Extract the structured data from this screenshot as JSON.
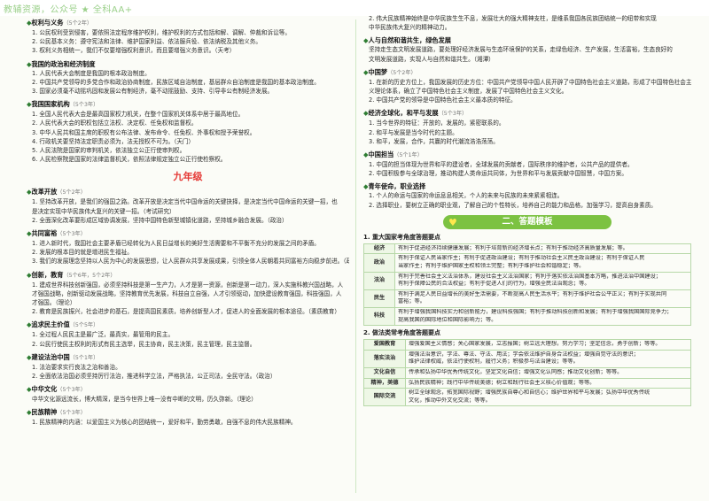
{
  "watermark": "教辅资源，公众号 ★ 全科AA+",
  "left": {
    "s1_title": "权利与义务",
    "s1_ref": "（5个2年）",
    "s1_items": [
      "1. 公民权利受到侵害，要依照法定程序维护权利，维护权利的方式包括和解、调解、仲裁和诉讼等。",
      "2. 公民基本义务：遵守宪法和法律、维护国家利益、依法服兵役、依法纳税及其他义务。",
      "3. 权利义务相统一，我们不仅要增强权利意识，而且要增强义务意识。（天考）"
    ],
    "s2_title": "我国的政治和经济制度",
    "s2_items": [
      "1. 人民代表大会制度是我国的根本政治制度。",
      "2. 中国共产党领导的多党合作和政治协商制度，民族区域自治制度，基层群众自治制度是我国的基本政治制度。",
      "3. 国家必须毫不动摇巩固和发展公有制经济，毫不动摇鼓励、支持、引导非公有制经济发展。"
    ],
    "s3_title": "我国国家机构",
    "s3_ref": "（5个3年）",
    "s3_items": [
      "1. 全国人民代表大会是最高国家权力机关，在整个国家机关体系中居于最高地位。",
      "2. 人民代表大会的职权包括立法权、决定权、任免权和监督权。",
      "3. 中华人民共和国主席的职权有公布法律、发布命令、任免权、外事权和授予荣誉权。",
      "4. 行政机关要坚持法定职责必须为，法无授权不可为。（天门）",
      "5. 人民法院是国家的审判机关，依法独立公正行使审判权。",
      "6. 人民检察院是国家的法律监督机关，依照法律规定独立公正行使检察权。"
    ],
    "grade": "九年级",
    "s4_title": "改革开放",
    "s4_ref": "（5个2年）",
    "s4_items": [
      "1. 坚持改革开放，是我们的强国之路。改革开放是决定当代中国命运的关键抉择，是决定当代中国命运的关键一招，也",
      "   是决定实现中华民族伟大复兴的关键一招。（考试研究）",
      "2. 全面深化改革要形成区域协调发展，坚持中国特色新型城镇化道路，坚持城乡融合发展。（政治）"
    ],
    "s5_title": "共同富裕",
    "s5_ref": "（5个3年）",
    "s5_items": [
      "1. 进入新时代，我国社会主要矛盾已经转化为人民日益增长的美好生活需要和不平衡不充分的发展之间的矛盾。",
      "2. 发展的根本目的就是增进民生福祉。",
      "3. 我们的发展理念坚持以人民为中心的发展思想，让人民群众共享发展成果，引领全体人民朝着共同富裕方向稳步前进。（政治）"
    ],
    "s6_title": "创新，教育",
    "s6_ref": "（5个6年，5个2年）",
    "s6_items": [
      "1. 建成世界科技创新强国，必须坚持科技是第一生产力，人才是第一资源，创新是第一动力，深入实施科教兴国战略，人",
      "   才强国战略，创新驱动发展战略，坚持教育优先发展，科技自立自强，人才引领驱动，加快建设教育强国，科技强国，人",
      "   才强国。（理论）",
      "2. 教育是民族振兴，社会进步的基石，是提高国民素质，培养创新型人才，促进人的全面发展的根本途径。（素质教育）"
    ],
    "s7_title": "追求民主价值",
    "s7_ref": "（5个5年）",
    "s7_items": [
      "1. 全过程人民民主是最广泛，最真实，最管用的民主。",
      "2. 公民行使民主权利的形式有民主选举，民主协商，民主决策，民主管理，民主监督。"
    ],
    "s8_title": "建设法治中国",
    "s8_ref": "（5个1年）",
    "s8_items": [
      "1. 法治要求实行良法之治和善治。",
      "2. 全面依法治国必须坚持厉行法治，推进科学立法，严格执法，公正司法，全民守法。（政治）"
    ],
    "s9_title": "中华文化",
    "s9_ref": "（5个3年）",
    "s9_items": [
      "   中华文化源远流长，博大精深，是当今世界上唯一没有中断的文明，历久弥新。（理论）"
    ],
    "s10_title": "民族精神",
    "s10_ref": "（5个3年）",
    "s10_items": [
      "1. 民族精神的内涵：以爱国主义为核心的团结统一，爱好和平，勤劳勇敢，自强不息的伟大民族精神。"
    ]
  },
  "right": {
    "r0_items": [
      "2. 伟大民族精神始终是中华民族生生不息，发展壮大的强大精神支柱，是维系我国各民族团结统一的纽带和实现",
      "   中华民族伟大复兴的精神动力。"
    ],
    "r1_title": "人与自然和谐共生，绿色发展",
    "r1_items": [
      "   坚持走生态文明发展道路，要处理好经济发展与生态环境保护的关系，走绿色经济、生产发展，生活富裕，生态良好的",
      "   文明发展道路，实现人与自然和谐共生。（湘潭）"
    ],
    "r2_title": "中国梦",
    "r2_ref": "（5个2年）",
    "r2_items": [
      "1. 在新的历史方位上，我国发展的历史方位：中国共产党领导中国人民开辟了中国特色社会主义道路，形成了中国特色社会主",
      "   义理论体系，确立了中国特色社会主义制度，发展了中国特色社会主义文化。",
      "2. 中国共产党的领导是中国特色社会主义最本质的特征。"
    ],
    "r3_title": "经济全球化，和平与发展",
    "r3_ref": "（5个3年）",
    "r3_items": [
      "1. 当今世界的特征：开放的，发展的，紧密联系的。",
      "2. 和平与发展是当今时代的主题。",
      "3. 和平，发展，合作，共赢的时代潮流浩浩荡荡。"
    ],
    "r4_title": "中国担当",
    "r4_ref": "（5个1年）",
    "r4_items": [
      "1. 中国的担当体现为世界和平的建设者，全球发展的贡献者，国际秩序的维护者，公共产品的提供者。",
      "2. 中国积极参与全球治理，推动构建人类命运共同体，为世界和平与发展贡献中国智慧，中国方案。"
    ],
    "r5_title": "青年使命，职业选择",
    "r5_items": [
      "1. 个人的命运与国家的命运息息相关，个人的未来与民族的未来紧紧相连。",
      "2. 选择职业，要树立正确的职业观，了解自己的个性特长，培养自己的能力和品格，加强学习，提高自身素质。"
    ],
    "banner": "二、答题模板",
    "t1_title": "1. 重大国家考角度答题要点",
    "t1_rows": [
      {
        "key": "经济",
        "lines": [
          "有利于促进经济持续健康发展；有利于培育新的经济增长点；有利于推动经济高质量发展；等。"
        ]
      },
      {
        "key": "政治",
        "lines": [
          "有利于保证人民当家作主；有利于促进政治建设；有利于推动社会主义民主政治建设；有利于保证人民",
          "当家作主；有利于维护国家主权和领土完整；有利于维护社会和谐稳定；等。"
        ]
      },
      {
        "key": "法治",
        "lines": [
          "有利于完善社会主义法治体系，建设社会主义法治国家；有利于落实依法治国基本方略，推进法治中国建设；",
          "有利于保障公民的合法权益；有利于促进人们的行为，增强全民法治观念；等。"
        ]
      },
      {
        "key": "民生",
        "lines": [
          "有利于满足人民日益增长的美好生活需要，不断提高人民生活水平；有利于维护社会公平正义；有利于实现共同",
          "富裕；等。"
        ]
      },
      {
        "key": "科技",
        "lines": [
          "有利于增强我国科技实力和创新能力，建设科技强国；有利于推动科技创新和发展；有利于增强我国国际竞争力；",
          "提高我国的国际地位和国际影响力；等。"
        ]
      }
    ],
    "t2_title": "2. 做法类常考角度答题要点",
    "t2_rows": [
      {
        "key": "爱国教育",
        "lines": [
          "增强爱国主义情感；关心国家发展，立志报国；树立远大理想，努力学习；坚定信念，勇于创新；等等。"
        ]
      },
      {
        "key": "落实法治",
        "lines": [
          "增强法治意识，学法、尊法、守法、用法；学会依法维护自身合法权益；增强自觉守法的意识；",
          "维护法律权威，依法行使权利，履行义务；积极参与法治建设；等等。"
        ]
      },
      {
        "key": "文化自信",
        "lines": [
          "传承和弘扬中华优秀传统文化，坚定文化自信；增强文化认同感；推动文化创新；等等。"
        ]
      },
      {
        "key": "精神，美德",
        "lines": [
          "弘扬民族精神；践行中华传统美德；树立和践行社会主义核心价值观；等等。"
        ]
      },
      {
        "key": "国际交流",
        "lines": [
          "树立全球观念，拓宽国际视野；增强民族自尊心和自信心；维护世界和平与发展；弘扬中华优秀传统",
          "文化，推动中外文化交流；等等。"
        ]
      }
    ]
  },
  "colors": {
    "accent": "#1b7a2e",
    "highlight": "#c62828",
    "banner": "#7cc242",
    "watermark": "#9bd08a"
  }
}
